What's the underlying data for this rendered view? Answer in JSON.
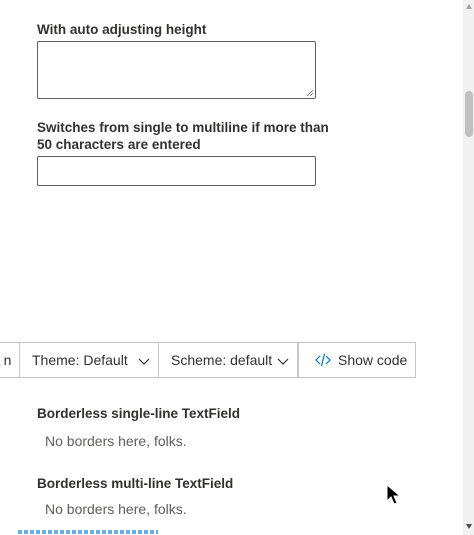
{
  "fields": {
    "auto_height_label": "With auto adjusting height",
    "switch_label_line1": "Switches from single to multiline if more than",
    "switch_label_line2": "50 characters are entered",
    "auto_height_value": "",
    "switch_value": ""
  },
  "toolbar": {
    "cut_left_label": "n",
    "theme_label": "Theme: Default",
    "scheme_label": "Scheme: default",
    "show_code_label": "Show code"
  },
  "borderless": {
    "single_heading": "Borderless single-line TextField",
    "single_value": "No borders here, folks.",
    "multi_heading": "Borderless multi-line TextField",
    "multi_value": "No borders here, folks."
  },
  "colors": {
    "accent": "#0078d4",
    "border": "#605e5c",
    "text": "#323130"
  },
  "icons": {
    "dropdown": "chevron-down-icon",
    "code": "code-icon"
  }
}
